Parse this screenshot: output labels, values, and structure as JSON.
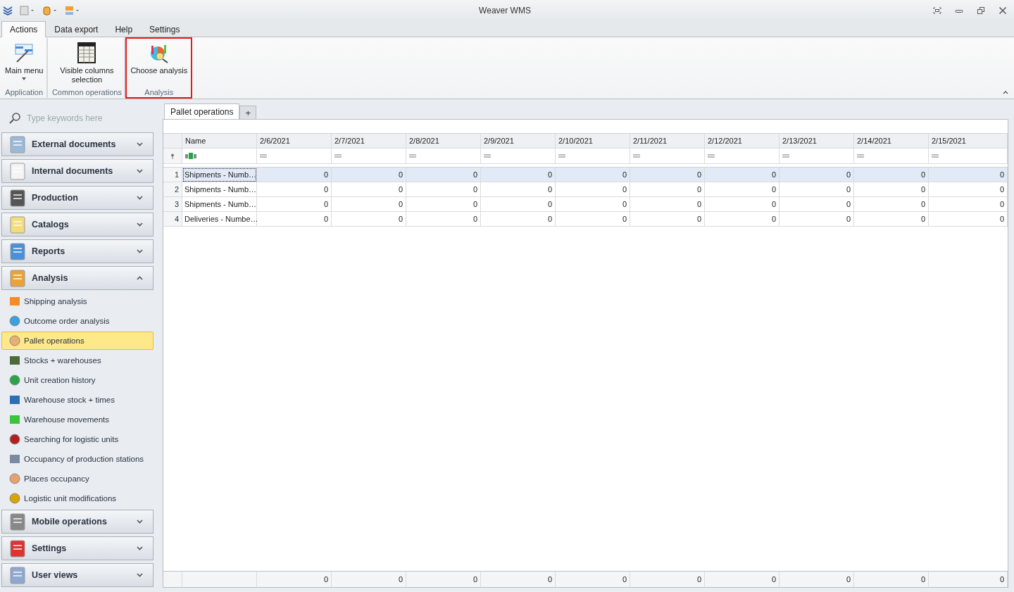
{
  "window": {
    "title": "Weaver WMS"
  },
  "ribbon": {
    "tabs": [
      {
        "label": "Actions",
        "selected": true
      },
      {
        "label": "Data export",
        "selected": false
      },
      {
        "label": "Help",
        "selected": false
      },
      {
        "label": "Settings",
        "selected": false
      }
    ],
    "groups": [
      {
        "caption": "Application",
        "highlighted": false,
        "buttons": [
          {
            "label": "Main menu",
            "dropdown": true
          }
        ]
      },
      {
        "caption": "Common operations",
        "highlighted": false,
        "buttons": [
          {
            "label": "Visible columns selection",
            "dropdown": false
          }
        ]
      },
      {
        "caption": "Analysis",
        "highlighted": true,
        "buttons": [
          {
            "label": "Choose analysis",
            "dropdown": false
          }
        ]
      }
    ]
  },
  "sidebar": {
    "search": {
      "placeholder": "Type keywords here"
    },
    "groups": [
      {
        "label": "External documents",
        "expanded": false
      },
      {
        "label": "Internal documents",
        "expanded": false
      },
      {
        "label": "Production",
        "expanded": false
      },
      {
        "label": "Catalogs",
        "expanded": false
      },
      {
        "label": "Reports",
        "expanded": false
      },
      {
        "label": "Analysis",
        "expanded": true,
        "items": [
          {
            "label": "Shipping analysis",
            "selected": false
          },
          {
            "label": "Outcome order analysis",
            "selected": false
          },
          {
            "label": "Pallet operations",
            "selected": true
          },
          {
            "label": "Stocks + warehouses",
            "selected": false
          },
          {
            "label": "Unit creation history",
            "selected": false
          },
          {
            "label": "Warehouse stock + times",
            "selected": false
          },
          {
            "label": "Warehouse movements",
            "selected": false
          },
          {
            "label": "Searching for logistic units",
            "selected": false
          },
          {
            "label": "Occupancy of production stations",
            "selected": false
          },
          {
            "label": "Places occupancy",
            "selected": false
          },
          {
            "label": "Logistic unit modifications",
            "selected": false
          }
        ]
      },
      {
        "label": "Mobile operations",
        "expanded": false
      },
      {
        "label": "Settings",
        "expanded": false
      },
      {
        "label": "User views",
        "expanded": false
      }
    ]
  },
  "document_tabs": [
    {
      "label": "Pallet operations",
      "selected": true
    }
  ],
  "add_tab": "+",
  "table": {
    "columns": [
      "Name",
      "2/6/2021",
      "2/7/2021",
      "2/8/2021",
      "2/9/2021",
      "2/10/2021",
      "2/11/2021",
      "2/12/2021",
      "2/13/2021",
      "2/14/2021",
      "2/15/2021"
    ],
    "rows": [
      {
        "number": "1",
        "selected": true,
        "cells": [
          "Shipments - Numb…",
          "0",
          "0",
          "0",
          "0",
          "0",
          "0",
          "0",
          "0",
          "0",
          "0"
        ]
      },
      {
        "number": "2",
        "selected": false,
        "cells": [
          "Shipments - Numb…",
          "0",
          "0",
          "0",
          "0",
          "0",
          "0",
          "0",
          "0",
          "0",
          "0"
        ]
      },
      {
        "number": "3",
        "selected": false,
        "cells": [
          "Shipments - Numb…",
          "0",
          "0",
          "0",
          "0",
          "0",
          "0",
          "0",
          "0",
          "0",
          "0"
        ]
      },
      {
        "number": "4",
        "selected": false,
        "cells": [
          "Deliveries - Numbe…",
          "0",
          "0",
          "0",
          "0",
          "0",
          "0",
          "0",
          "0",
          "0",
          "0"
        ]
      }
    ],
    "totals": [
      "0",
      "0",
      "0",
      "0",
      "0",
      "0",
      "0",
      "0",
      "0",
      "0"
    ]
  }
}
